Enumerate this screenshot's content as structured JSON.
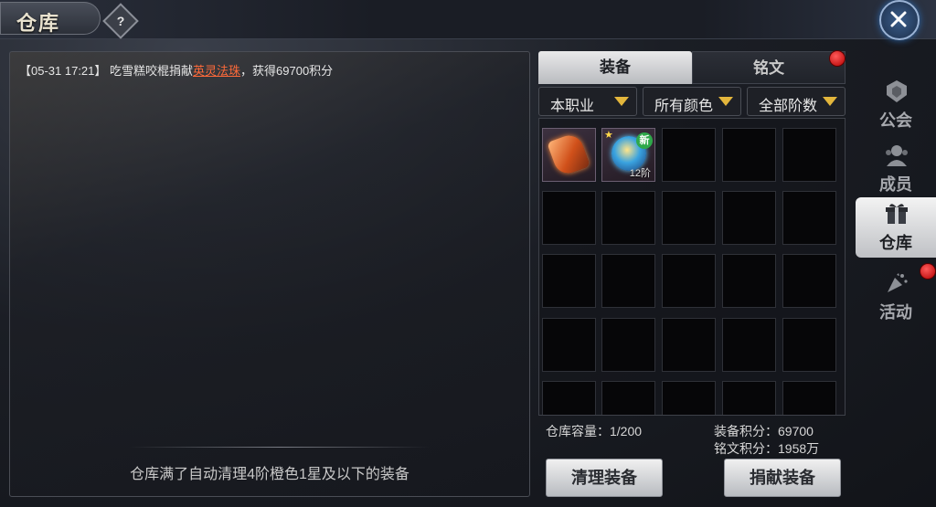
{
  "header": {
    "title": "仓库",
    "help_symbol": "?"
  },
  "log": {
    "entry_prefix": "【05-31 17:21】 吃雪糕咬棍捐献",
    "entry_item": "英灵法珠",
    "entry_suffix": "，获得69700积分",
    "footer": "仓库满了自动清理4阶橙色1星及以下的装备"
  },
  "tabs": [
    {
      "label": "装备"
    },
    {
      "label": "铭文"
    }
  ],
  "filters": [
    {
      "label": "本职业"
    },
    {
      "label": "所有颜色"
    },
    {
      "label": "全部阶数"
    }
  ],
  "items": [
    {
      "icon": "orange-gem-icon"
    },
    {
      "icon": "blue-orb-icon",
      "badge": "新",
      "tier": "12阶"
    }
  ],
  "info": {
    "capacity": "仓库容量：1/200",
    "equip_score": "装备积分：69700",
    "rune_score": "铭文积分：1958万"
  },
  "buttons": {
    "clean": "清理装备",
    "donate": "捐献装备"
  },
  "sidenav": [
    {
      "label": "公会",
      "icon": "guild-icon"
    },
    {
      "label": "成员",
      "icon": "members-icon"
    },
    {
      "label": "仓库",
      "icon": "gift-icon",
      "active": true
    },
    {
      "label": "活动",
      "icon": "event-icon"
    }
  ],
  "colors": {
    "highlight": "#ff6a3a",
    "accent_gold": "#e3b63c",
    "notify_red": "#d40000"
  }
}
